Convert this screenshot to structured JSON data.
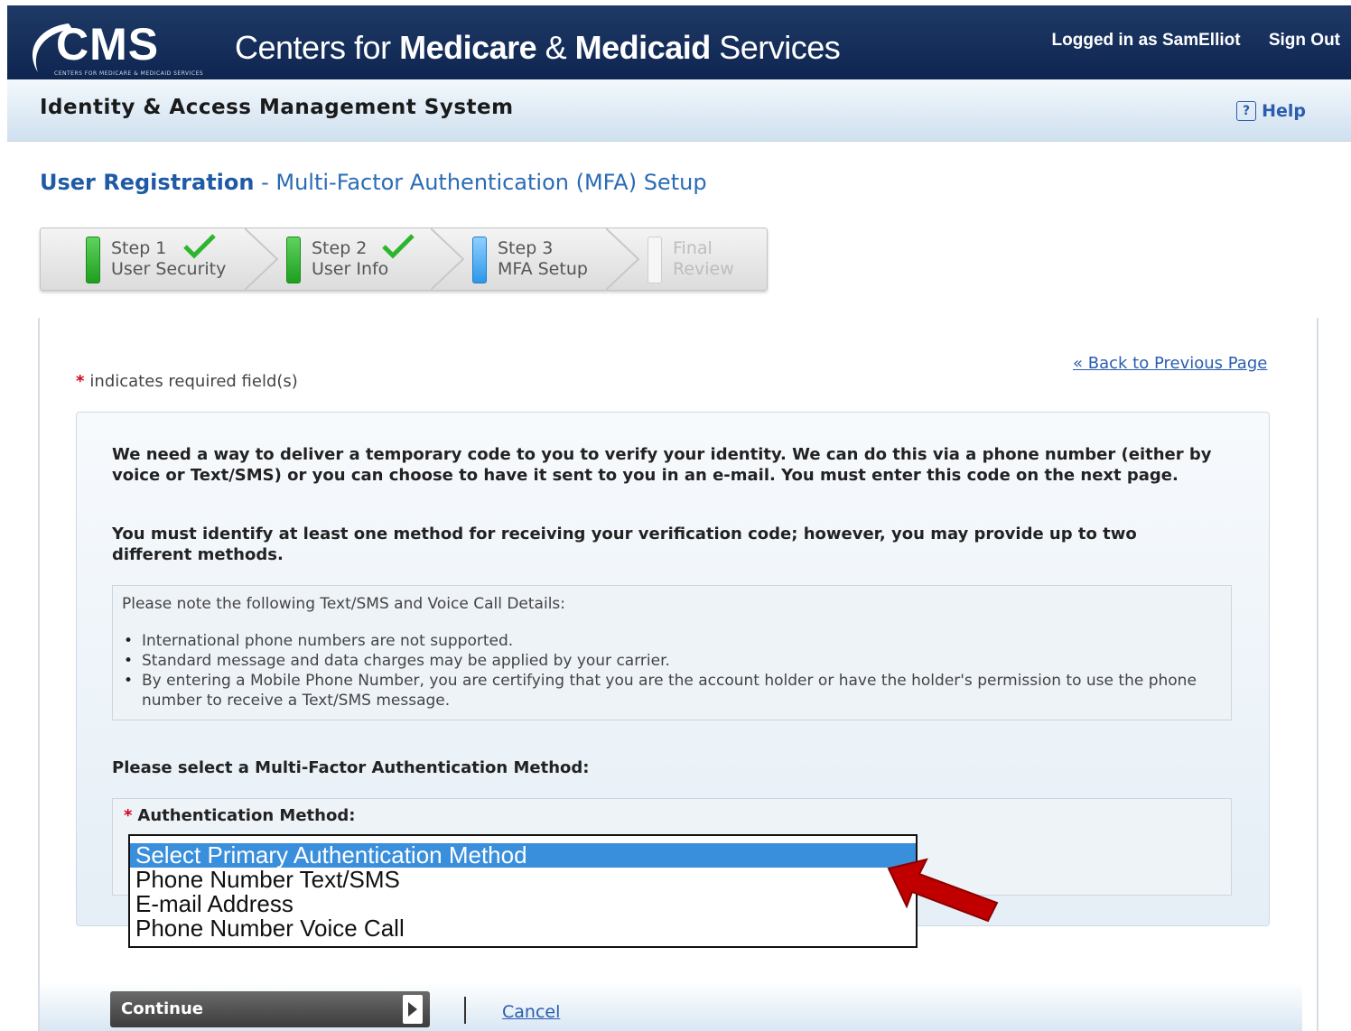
{
  "header": {
    "logo_text": "CMS",
    "logo_subtext": "CENTERS FOR MEDICARE & MEDICAID SERVICES",
    "agency_prefix": "Centers for ",
    "agency_medicare": "Medicare",
    "agency_amp": " & ",
    "agency_medicaid": "Medicaid",
    "agency_suffix": " Services",
    "logged_in": "Logged in as SamElliot",
    "sign_out": "Sign Out"
  },
  "subheader": {
    "system_title": "Identity & Access Management System",
    "help_label": "Help",
    "help_icon": "?"
  },
  "page": {
    "title_bold": "User Registration",
    "title_rest": " - Multi-Factor Authentication (MFA) Setup",
    "back_link": "« Back to Previous Page",
    "required_note": "indicates required field(s)",
    "required_marker": "*"
  },
  "steps": [
    {
      "line1": "Step 1",
      "line2": "User Security",
      "status": "complete",
      "bar_color": "#2db52d"
    },
    {
      "line1": "Step 2",
      "line2": "User Info",
      "status": "complete",
      "bar_color": "#2db52d"
    },
    {
      "line1": "Step 3",
      "line2": "MFA Setup",
      "status": "current",
      "bar_color": "#3fa9f5"
    },
    {
      "line1": "Final",
      "line2": "Review",
      "status": "pending",
      "bar_color": "#f2f2f2"
    }
  ],
  "content": {
    "para1": "We need a way to deliver a temporary code to you to verify your identity. We can do this via a phone number (either by voice or Text/SMS) or you can choose to have it sent to you in an e-mail. You must enter this code on the next page.",
    "para2": "You must identify at least one method for receiving your verification code; however, you may provide up to two different methods.",
    "note_title": "Please note the following Text/SMS and Voice Call Details:",
    "note_items": [
      "International phone numbers are not supported.",
      "Standard message and data charges may be applied by your carrier.",
      "By entering a Mobile Phone Number, you are certifying that you are the account holder or have the holder's permission to use the phone number to receive a Text/SMS message."
    ],
    "select_prompt": "Please select a Multi-Factor Authentication Method:",
    "method_label": "Authentication Method:"
  },
  "auth_method_options": [
    {
      "label": "Select Primary Authentication Method",
      "selected": true
    },
    {
      "label": "Phone Number Text/SMS",
      "selected": false
    },
    {
      "label": "E-mail Address",
      "selected": false
    },
    {
      "label": "Phone Number Voice Call",
      "selected": false
    }
  ],
  "footer": {
    "continue_label": "Continue",
    "cancel_label": "Cancel"
  },
  "colors": {
    "header_bg": "#0e2550",
    "link": "#2a5db0",
    "required": "#d0021b",
    "selected_option": "#3a8fdc",
    "annotation_arrow": "#c00000"
  }
}
